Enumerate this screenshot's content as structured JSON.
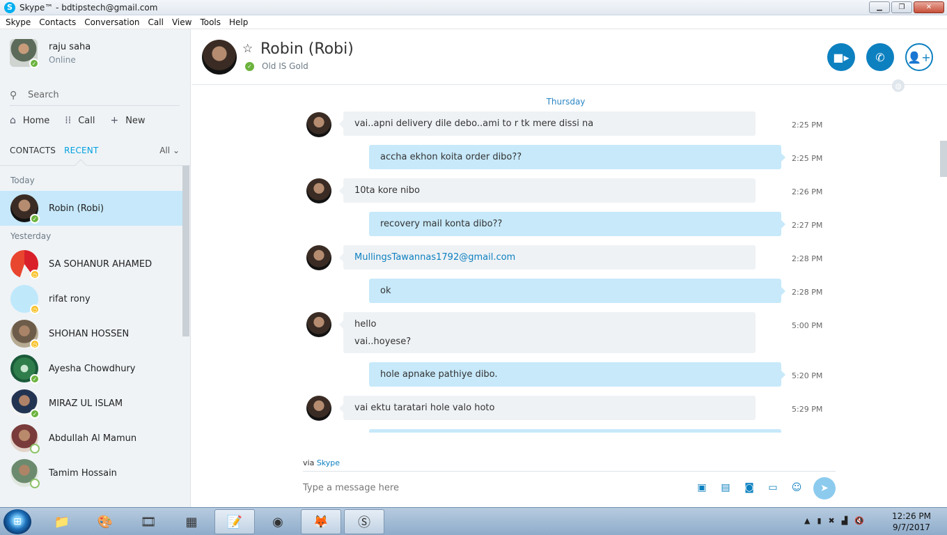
{
  "window": {
    "title": "Skype™ - bdtipstech@gmail.com",
    "minimize": "▁",
    "restore": "❐",
    "close": "✕"
  },
  "menu": [
    "Skype",
    "Contacts",
    "Conversation",
    "Call",
    "View",
    "Tools",
    "Help"
  ],
  "profile": {
    "name": "raju saha",
    "status": "Online"
  },
  "search": {
    "placeholder": "Search"
  },
  "nav": {
    "home": "Home",
    "call": "Call",
    "new": "New"
  },
  "tabs": {
    "contacts": "CONTACTS",
    "recent": "RECENT",
    "filter": "All"
  },
  "groups": {
    "today": "Today",
    "yesterday": "Yesterday"
  },
  "contacts": [
    {
      "name": "Robin (Robi)",
      "status": "online"
    },
    {
      "name": "SA SOHANUR AHAMED",
      "status": "away"
    },
    {
      "name": "rifat rony",
      "status": "away"
    },
    {
      "name": "SHOHAN HOSSEN",
      "status": "away"
    },
    {
      "name": "Ayesha Chowdhury",
      "status": "online"
    },
    {
      "name": "MIRAZ UL ISLAM",
      "status": "online"
    },
    {
      "name": "Abdullah Al Mamun",
      "status": "offline"
    },
    {
      "name": "Tamim Hossain",
      "status": "offline"
    }
  ],
  "header": {
    "contact_name": "Robin (Robi)",
    "mood": "Old IS Gold"
  },
  "conversation": {
    "day": "Thursday",
    "messages": [
      {
        "dir": "in",
        "lines": [
          "vai..apni delivery dile debo..ami to r tk mere dissi na"
        ],
        "time": "2:25 PM"
      },
      {
        "dir": "out",
        "lines": [
          "accha ekhon koita order dibo??"
        ],
        "time": "2:25 PM"
      },
      {
        "dir": "in",
        "lines": [
          "10ta kore nibo"
        ],
        "time": "2:26 PM"
      },
      {
        "dir": "out",
        "lines": [
          "recovery mail konta dibo??"
        ],
        "time": "2:27 PM"
      },
      {
        "dir": "in",
        "lines": [
          "MullingsTawannas1792@gmail.com"
        ],
        "time": "2:28 PM"
      },
      {
        "dir": "out",
        "lines": [
          "ok"
        ],
        "time": "2:28 PM"
      },
      {
        "dir": "in",
        "lines": [
          "hello",
          "vai..hoyese?"
        ],
        "time": "5:00 PM"
      },
      {
        "dir": "out",
        "lines": [
          "hole apnake pathiye dibo."
        ],
        "time": "5:20 PM"
      },
      {
        "dir": "in",
        "lines": [
          "vai ektu taratari hole valo hoto"
        ],
        "time": "5:29 PM"
      }
    ]
  },
  "composer": {
    "via_prefix": "via",
    "via_link": "Skype",
    "placeholder": "Type a message here"
  },
  "taskbar": {
    "time": "12:26 PM",
    "date": "9/7/2017"
  },
  "colors": {
    "accent": "#0d80c0",
    "selected": "#c6e8fa",
    "bubble_out": "#c7e9fa",
    "bubble_in": "#eff2f5",
    "online": "#6cb33e",
    "away": "#f8c024"
  }
}
